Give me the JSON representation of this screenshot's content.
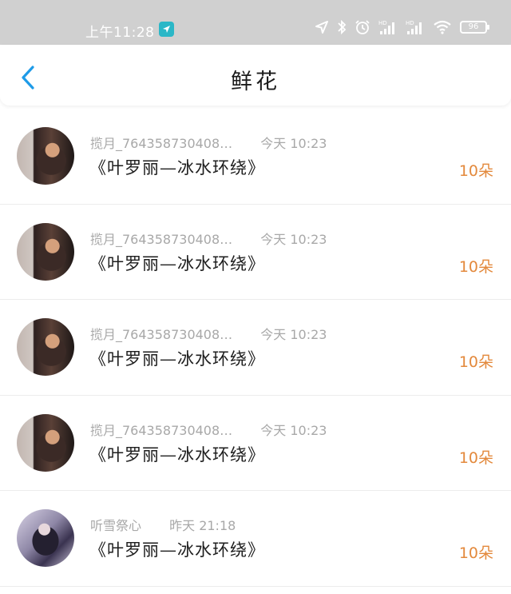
{
  "status_bar": {
    "time": "上午11:28",
    "battery": "96",
    "icons": [
      "location-arrow-icon",
      "bluetooth-icon",
      "alarm-icon",
      "signal-hd-1-icon",
      "signal-hd-2-icon",
      "wifi-icon",
      "battery-icon"
    ]
  },
  "header": {
    "title": "鲜花",
    "back_icon": "chevron-left-icon"
  },
  "list": [
    {
      "author": "揽月_764358730408…",
      "time": "今天 10:23",
      "book": "《叶罗丽—冰水环绕》",
      "count": "10朵",
      "avatar": "style-a"
    },
    {
      "author": "揽月_764358730408…",
      "time": "今天 10:23",
      "book": "《叶罗丽—冰水环绕》",
      "count": "10朵",
      "avatar": "style-a"
    },
    {
      "author": "揽月_764358730408…",
      "time": "今天 10:23",
      "book": "《叶罗丽—冰水环绕》",
      "count": "10朵",
      "avatar": "style-a"
    },
    {
      "author": "揽月_764358730408…",
      "time": "今天 10:23",
      "book": "《叶罗丽—冰水环绕》",
      "count": "10朵",
      "avatar": "style-a"
    },
    {
      "author": "听雪祭心",
      "time": "昨天 21:18",
      "book": "《叶罗丽—冰水环绕》",
      "count": "10朵",
      "avatar": "style-b"
    }
  ],
  "colors": {
    "accent": "#1e9be8",
    "count": "#e3893c",
    "meta": "#a8a8a8",
    "status_bar": "#d0d0d0"
  }
}
